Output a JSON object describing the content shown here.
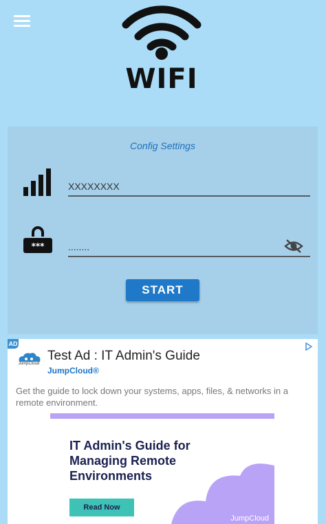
{
  "header": {
    "logo_text": "WIFI"
  },
  "config": {
    "title": "Config Settings",
    "ssid": {
      "value": "XXXXXXXX"
    },
    "password": {
      "value": "........"
    },
    "start_label": "START"
  },
  "ad": {
    "badge": "AD",
    "logo_text": "JumpCloud",
    "title": "Test Ad : IT Admin's Guide",
    "advertiser": "JumpCloud®",
    "description": "Get the guide to lock down your systems, apps, files, & networks in a remote environment.",
    "creative": {
      "heading": "IT Admin's Guide for Managing Remote Environments",
      "cta_label": "Read Now",
      "brand": "JumpCloud"
    }
  },
  "colors": {
    "background": "#aadcf8",
    "card": "#a6d0ea",
    "accent": "#1f79c8",
    "ad_purple": "#b9a3f7",
    "ad_teal": "#3ec2b6"
  }
}
